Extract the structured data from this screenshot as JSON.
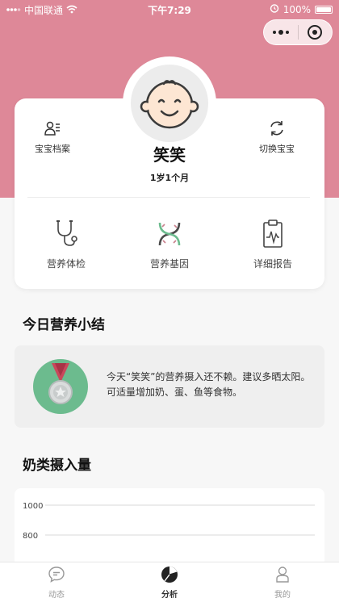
{
  "status_bar": {
    "carrier": "中国联通",
    "time": "下午7:29",
    "battery": "100%",
    "battery_level": 1.0
  },
  "profile": {
    "name": "笑笑",
    "age": "1岁1个月",
    "archive_label": "宝宝档案",
    "switch_label": "切换宝宝"
  },
  "features": [
    {
      "label": "营养体检",
      "icon": "stethoscope-icon"
    },
    {
      "label": "营养基因",
      "icon": "dna-icon"
    },
    {
      "label": "详细报告",
      "icon": "report-icon"
    }
  ],
  "summary": {
    "title": "今日营养小结",
    "text": "今天“笑笑”的营养摄入还不赖。建议多晒太阳。可适量增加奶、蛋、鱼等食物。",
    "icon": "medal-icon"
  },
  "milk": {
    "title": "奶类摄入量",
    "chart_data": {
      "type": "line",
      "y_ticks": [
        "1000",
        "800"
      ],
      "grid": true
    }
  },
  "tabbar": [
    {
      "label": "动态",
      "icon": "chat-icon",
      "active": false
    },
    {
      "label": "分析",
      "icon": "pie-chart-icon",
      "active": true
    },
    {
      "label": "我的",
      "icon": "person-icon",
      "active": false
    }
  ],
  "colors": {
    "header": "#de8898",
    "medal": "#6cbb8e"
  }
}
